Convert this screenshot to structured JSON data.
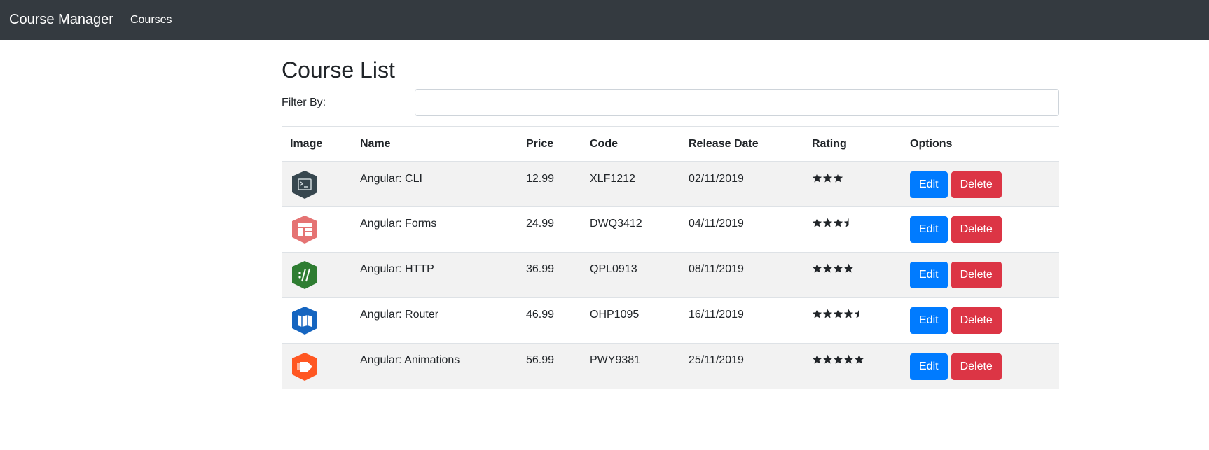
{
  "navbar": {
    "brand": "Course Manager",
    "links": [
      "Courses"
    ],
    "background": "#343a40"
  },
  "page": {
    "title": "Course List",
    "filter_label": "Filter By:",
    "filter_value": "",
    "filter_placeholder": ""
  },
  "table": {
    "headers": [
      "Image",
      "Name",
      "Price",
      "Code",
      "Release Date",
      "Rating",
      "Options"
    ],
    "rows": [
      {
        "name": "Angular: CLI",
        "price": "12.99",
        "code": "XLF1212",
        "release_date": "02/11/2019",
        "rating": 3,
        "icon": "terminal-icon",
        "icon_color": "#37474f"
      },
      {
        "name": "Angular: Forms",
        "price": "24.99",
        "code": "DWQ3412",
        "release_date": "04/11/2019",
        "rating": 3.5,
        "icon": "form-layout-icon",
        "icon_color": "#e57373"
      },
      {
        "name": "Angular: HTTP",
        "price": "36.99",
        "code": "QPL0913",
        "release_date": "08/11/2019",
        "rating": 4,
        "icon": "http-slashes-icon",
        "icon_color": "#2e7d32"
      },
      {
        "name": "Angular: Router",
        "price": "46.99",
        "code": "OHP1095",
        "release_date": "16/11/2019",
        "rating": 4.5,
        "icon": "map-icon",
        "icon_color": "#1565c0"
      },
      {
        "name": "Angular: Animations",
        "price": "56.99",
        "code": "PWY9381",
        "release_date": "25/11/2019",
        "rating": 5,
        "icon": "animation-arrow-icon",
        "icon_color": "#ff5722"
      }
    ]
  },
  "buttons": {
    "edit_label": "Edit",
    "delete_label": "Delete",
    "edit_color": "#007bff",
    "delete_color": "#dc3545"
  }
}
